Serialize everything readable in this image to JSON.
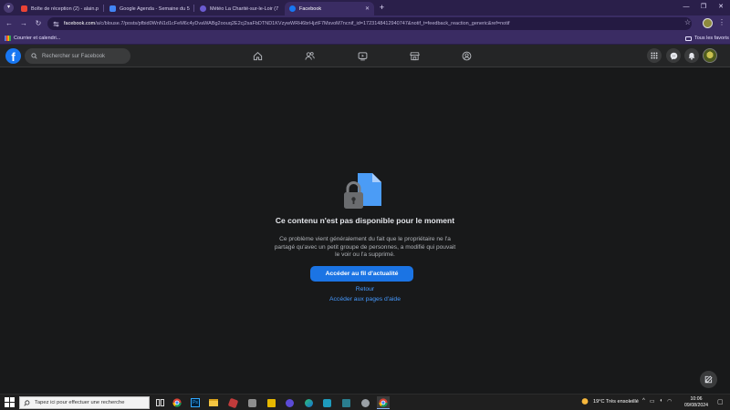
{
  "browser": {
    "tabs": [
      {
        "title": "Boîte de réception (2) - alain.p",
        "favicon_color": "#ea4335",
        "active": false
      },
      {
        "title": "Google Agenda - Semaine du 5",
        "favicon_color": "#4285f4",
        "active": false
      },
      {
        "title": "Météo La Charité-sur-le-Loir (7",
        "favicon_color": "#6b5bd1",
        "active": false
      },
      {
        "title": "Facebook",
        "favicon_color": "#1877f2",
        "active": true
      }
    ],
    "url_domain": "facebook.com",
    "url_rest": "/a/c/blouse.7/posts/pfbid0WnN1d1cFeM6c4yDvaWABg2oouq2E2cj2saFbDTND1KVzywWRH6brHjztF7MsvoM7ncnif_id=1723148412940747&notif_t=feedback_reaction_generic&ref=notif",
    "bookmarks": [
      {
        "label": "Courrier et calendri..."
      },
      {
        "label": "Tous les favoris"
      }
    ]
  },
  "facebook": {
    "logo": "f",
    "search_placeholder": "Rechercher sur Facebook"
  },
  "content": {
    "title": "Ce contenu n'est pas disponible pour le moment",
    "body": "Ce problème vient généralement du fait que le propriétaire ne l'a partagé qu'avec un petit groupe de personnes, a modifié qui pouvait le voir ou l'a supprimé.",
    "primary_button": "Accéder au fil d'actualité",
    "back_link": "Retour",
    "help_link": "Accéder aux pages d'aide"
  },
  "taskbar": {
    "search_placeholder": "Tapez ici pour effectuer une recherche",
    "weather": "19°C  Très ensoleillé",
    "time": "10:06",
    "date": "09/08/2024"
  },
  "colors": {
    "facebook_blue": "#1877f2",
    "link_blue": "#4599ff",
    "page_bg": "#18191a",
    "browser_frame": "#3a2c63"
  }
}
